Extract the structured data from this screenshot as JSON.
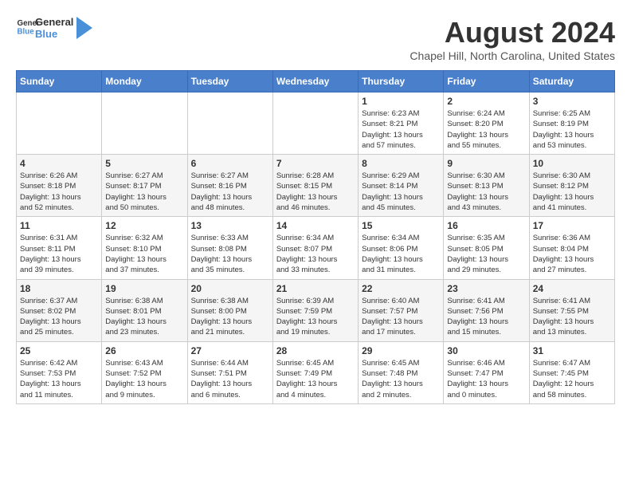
{
  "header": {
    "logo_general": "General",
    "logo_blue": "Blue",
    "month_year": "August 2024",
    "location": "Chapel Hill, North Carolina, United States"
  },
  "weekdays": [
    "Sunday",
    "Monday",
    "Tuesday",
    "Wednesday",
    "Thursday",
    "Friday",
    "Saturday"
  ],
  "weeks": [
    [
      {
        "day": "",
        "info": ""
      },
      {
        "day": "",
        "info": ""
      },
      {
        "day": "",
        "info": ""
      },
      {
        "day": "",
        "info": ""
      },
      {
        "day": "1",
        "info": "Sunrise: 6:23 AM\nSunset: 8:21 PM\nDaylight: 13 hours\nand 57 minutes."
      },
      {
        "day": "2",
        "info": "Sunrise: 6:24 AM\nSunset: 8:20 PM\nDaylight: 13 hours\nand 55 minutes."
      },
      {
        "day": "3",
        "info": "Sunrise: 6:25 AM\nSunset: 8:19 PM\nDaylight: 13 hours\nand 53 minutes."
      }
    ],
    [
      {
        "day": "4",
        "info": "Sunrise: 6:26 AM\nSunset: 8:18 PM\nDaylight: 13 hours\nand 52 minutes."
      },
      {
        "day": "5",
        "info": "Sunrise: 6:27 AM\nSunset: 8:17 PM\nDaylight: 13 hours\nand 50 minutes."
      },
      {
        "day": "6",
        "info": "Sunrise: 6:27 AM\nSunset: 8:16 PM\nDaylight: 13 hours\nand 48 minutes."
      },
      {
        "day": "7",
        "info": "Sunrise: 6:28 AM\nSunset: 8:15 PM\nDaylight: 13 hours\nand 46 minutes."
      },
      {
        "day": "8",
        "info": "Sunrise: 6:29 AM\nSunset: 8:14 PM\nDaylight: 13 hours\nand 45 minutes."
      },
      {
        "day": "9",
        "info": "Sunrise: 6:30 AM\nSunset: 8:13 PM\nDaylight: 13 hours\nand 43 minutes."
      },
      {
        "day": "10",
        "info": "Sunrise: 6:30 AM\nSunset: 8:12 PM\nDaylight: 13 hours\nand 41 minutes."
      }
    ],
    [
      {
        "day": "11",
        "info": "Sunrise: 6:31 AM\nSunset: 8:11 PM\nDaylight: 13 hours\nand 39 minutes."
      },
      {
        "day": "12",
        "info": "Sunrise: 6:32 AM\nSunset: 8:10 PM\nDaylight: 13 hours\nand 37 minutes."
      },
      {
        "day": "13",
        "info": "Sunrise: 6:33 AM\nSunset: 8:08 PM\nDaylight: 13 hours\nand 35 minutes."
      },
      {
        "day": "14",
        "info": "Sunrise: 6:34 AM\nSunset: 8:07 PM\nDaylight: 13 hours\nand 33 minutes."
      },
      {
        "day": "15",
        "info": "Sunrise: 6:34 AM\nSunset: 8:06 PM\nDaylight: 13 hours\nand 31 minutes."
      },
      {
        "day": "16",
        "info": "Sunrise: 6:35 AM\nSunset: 8:05 PM\nDaylight: 13 hours\nand 29 minutes."
      },
      {
        "day": "17",
        "info": "Sunrise: 6:36 AM\nSunset: 8:04 PM\nDaylight: 13 hours\nand 27 minutes."
      }
    ],
    [
      {
        "day": "18",
        "info": "Sunrise: 6:37 AM\nSunset: 8:02 PM\nDaylight: 13 hours\nand 25 minutes."
      },
      {
        "day": "19",
        "info": "Sunrise: 6:38 AM\nSunset: 8:01 PM\nDaylight: 13 hours\nand 23 minutes."
      },
      {
        "day": "20",
        "info": "Sunrise: 6:38 AM\nSunset: 8:00 PM\nDaylight: 13 hours\nand 21 minutes."
      },
      {
        "day": "21",
        "info": "Sunrise: 6:39 AM\nSunset: 7:59 PM\nDaylight: 13 hours\nand 19 minutes."
      },
      {
        "day": "22",
        "info": "Sunrise: 6:40 AM\nSunset: 7:57 PM\nDaylight: 13 hours\nand 17 minutes."
      },
      {
        "day": "23",
        "info": "Sunrise: 6:41 AM\nSunset: 7:56 PM\nDaylight: 13 hours\nand 15 minutes."
      },
      {
        "day": "24",
        "info": "Sunrise: 6:41 AM\nSunset: 7:55 PM\nDaylight: 13 hours\nand 13 minutes."
      }
    ],
    [
      {
        "day": "25",
        "info": "Sunrise: 6:42 AM\nSunset: 7:53 PM\nDaylight: 13 hours\nand 11 minutes."
      },
      {
        "day": "26",
        "info": "Sunrise: 6:43 AM\nSunset: 7:52 PM\nDaylight: 13 hours\nand 9 minutes."
      },
      {
        "day": "27",
        "info": "Sunrise: 6:44 AM\nSunset: 7:51 PM\nDaylight: 13 hours\nand 6 minutes."
      },
      {
        "day": "28",
        "info": "Sunrise: 6:45 AM\nSunset: 7:49 PM\nDaylight: 13 hours\nand 4 minutes."
      },
      {
        "day": "29",
        "info": "Sunrise: 6:45 AM\nSunset: 7:48 PM\nDaylight: 13 hours\nand 2 minutes."
      },
      {
        "day": "30",
        "info": "Sunrise: 6:46 AM\nSunset: 7:47 PM\nDaylight: 13 hours\nand 0 minutes."
      },
      {
        "day": "31",
        "info": "Sunrise: 6:47 AM\nSunset: 7:45 PM\nDaylight: 12 hours\nand 58 minutes."
      }
    ]
  ]
}
